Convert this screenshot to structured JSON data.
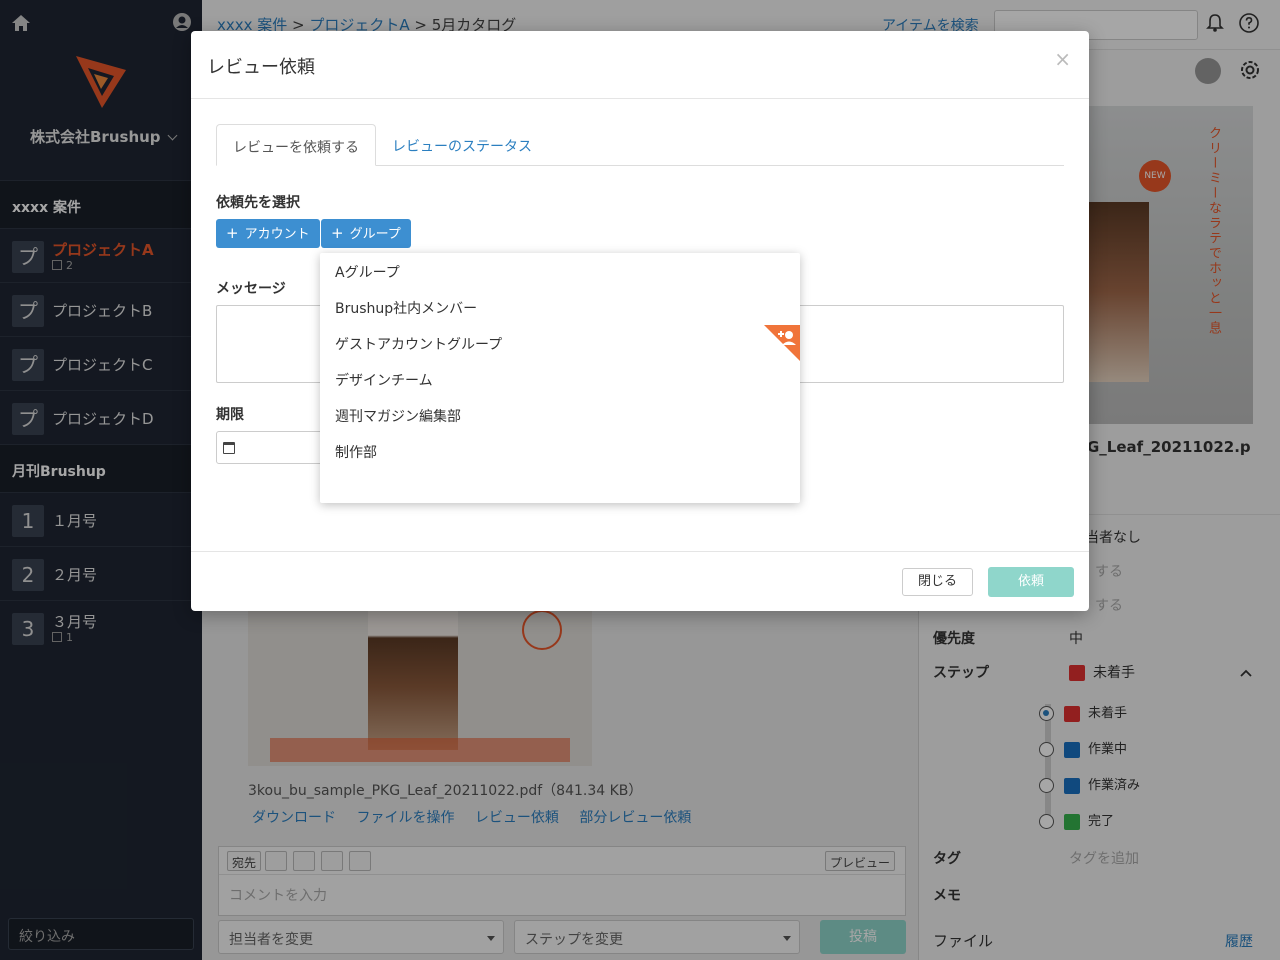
{
  "colors": {
    "accent": "#e8572a",
    "link": "#2b7fc0",
    "primary": "#3d8fd1",
    "disabled": "#8fd6cb",
    "sidebar_bg": "#1f2633"
  },
  "sidebar": {
    "company": "株式会社Brushup",
    "section1": "xxxx 案件",
    "projects": [
      {
        "badge": "プ",
        "name": "プロジェクトA",
        "count": "2"
      },
      {
        "badge": "プ",
        "name": "プロジェクトB"
      },
      {
        "badge": "プ",
        "name": "プロジェクトC"
      },
      {
        "badge": "プ",
        "name": "プロジェクトD"
      }
    ],
    "section2": "月刊Brushup",
    "issues": [
      {
        "badge": "1",
        "name": "１月号"
      },
      {
        "badge": "2",
        "name": "２月号"
      },
      {
        "badge": "3",
        "name": "３月号",
        "count": "1"
      }
    ],
    "filter_placeholder": "絞り込み"
  },
  "topbar": {
    "crumb1": "xxxx 案件",
    "sep1": " > ",
    "crumb2": "プロジェクトA",
    "sep2": " > ",
    "crumb3": "5月カタログ",
    "search_link": "アイテムを検索"
  },
  "content": {
    "file_meta": "3kou_bu_sample_PKG_Leaf_20211022.pdf（841.34 KB）",
    "links": [
      "ダウンロード",
      "ファイルを操作",
      "レビュー依頼",
      "部分レビュー依頼"
    ],
    "tools": [
      "宛先",
      "プレビュー"
    ],
    "comment_placeholder": "コメントを入力",
    "assignee_select": "担当者を変更",
    "step_select": "ステップを変更",
    "post_button": "投稿"
  },
  "rightpanel": {
    "thumb_vertical_text": "クリーミーなラテでホッと一息",
    "thumb_new": "NEW",
    "filename": "G_Leaf_20211022.p",
    "assignee_none": "当者なし",
    "faded1": "する",
    "faded2": "する",
    "priority_label": "優先度",
    "priority_value": "中",
    "step_label": "ステップ",
    "step_value": "未着手",
    "steps": [
      {
        "label": "未着手",
        "color": "#e03131"
      },
      {
        "label": "作業中",
        "color": "#1971c2"
      },
      {
        "label": "作業済み",
        "color": "#1971c2"
      },
      {
        "label": "完了",
        "color": "#37b24d"
      }
    ],
    "tag_label": "タグ",
    "tag_placeholder": "タグを追加",
    "memo_label": "メモ",
    "file_label": "ファイル",
    "history_link": "履歴"
  },
  "modal": {
    "title": "レビュー依頼",
    "close": "×",
    "tab_request": "レビューを依頼する",
    "tab_status": "レビューのステータス",
    "select_label": "依頼先を選択",
    "add_account": "アカウント",
    "add_group": "グループ",
    "message_label": "メッセージ",
    "deadline_label": "期限",
    "close_button": "閉じる",
    "submit_button": "依頼",
    "groups": [
      "Aグループ",
      "Brushup社内メンバー",
      "ゲストアカウントグループ",
      "デザインチーム",
      "週刊マガジン編集部",
      "制作部"
    ]
  }
}
